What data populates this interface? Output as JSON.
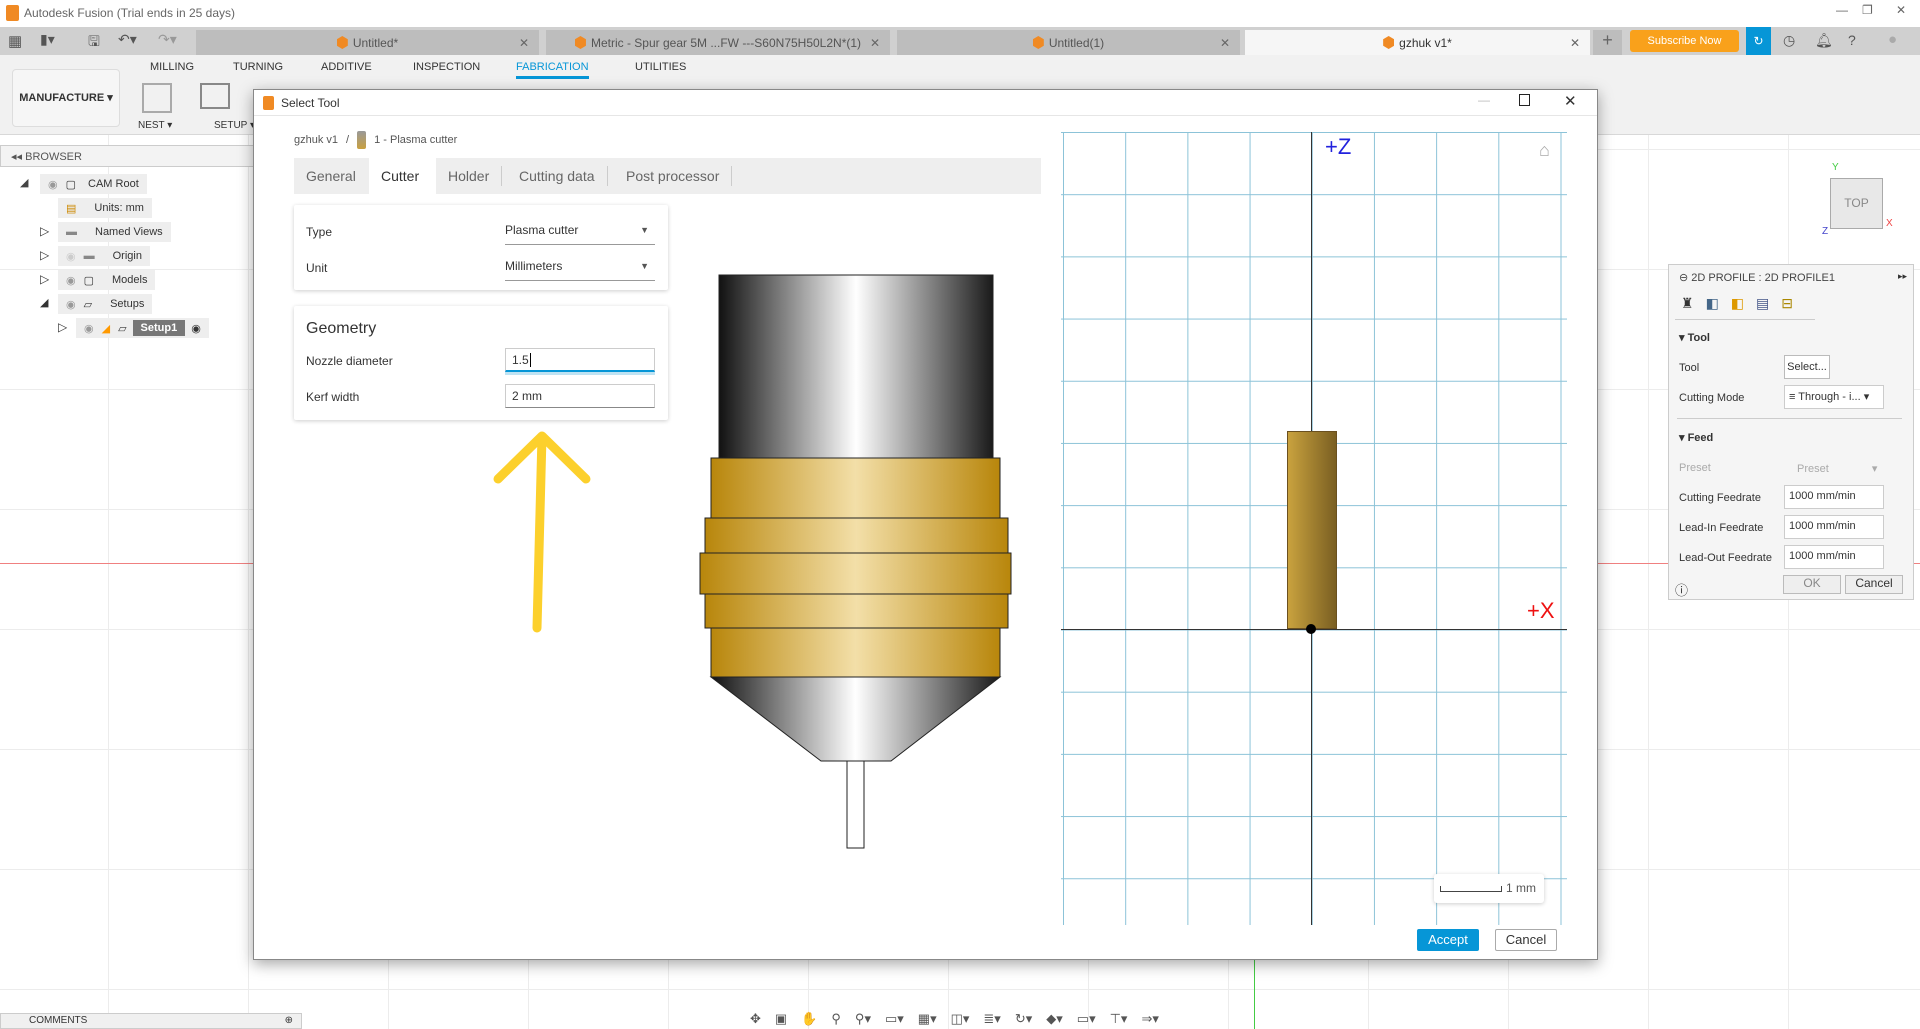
{
  "app": {
    "title": "Autodesk Fusion (Trial ends in 25 days)"
  },
  "doc_tabs": [
    {
      "label": "Untitled*"
    },
    {
      "label": "Metric - Spur gear 5M ...FW ---S60N75H50L2N*(1)"
    },
    {
      "label": "Untitled(1)"
    },
    {
      "label": "gzhuk v1*",
      "active": true
    }
  ],
  "header": {
    "subscribe": "Subscribe Now",
    "accent": "#f9a11b",
    "plus": "+"
  },
  "toolbar": {
    "workspace": "MANUFACTURE",
    "tabs": [
      "MILLING",
      "TURNING",
      "ADDITIVE",
      "INSPECTION",
      "FABRICATION",
      "UTILITIES"
    ],
    "active_tab": "FABRICATION",
    "nest": "NEST ▾",
    "setup": "SETUP ▾"
  },
  "browser": {
    "title": "BROWSER",
    "items": [
      {
        "label": "CAM Root"
      },
      {
        "label": "Units: mm"
      },
      {
        "label": "Named Views"
      },
      {
        "label": "Origin"
      },
      {
        "label": "Models"
      },
      {
        "label": "Setups"
      },
      {
        "label": "Setup1"
      }
    ]
  },
  "dialog": {
    "title": "Select Tool",
    "breadcrumb": {
      "root": "gzhuk v1",
      "sep": "/",
      "tool": "1 - Plasma cutter"
    },
    "tabs": [
      "General",
      "Cutter",
      "Holder",
      "Cutting data",
      "Post processor"
    ],
    "active_tab": "Cutter",
    "type_label": "Type",
    "type_value": "Plasma cutter",
    "unit_label": "Unit",
    "unit_value": "Millimeters",
    "geometry_title": "Geometry",
    "nozzle_label": "Nozzle diameter",
    "nozzle_value": "1.5",
    "kerf_label": "Kerf width",
    "kerf_value": "2 mm",
    "axis_z": "+Z",
    "axis_x": "+X",
    "scale": "1 mm",
    "accept": "Accept",
    "cancel": "Cancel",
    "accent": "#0696d7"
  },
  "panel": {
    "title": "2D PROFILE : 2D PROFILE1",
    "tool_section": "Tool",
    "tool_label": "Tool",
    "tool_button": "Select...",
    "mode_label": "Cutting Mode",
    "mode_value": "Through - i...",
    "feed_section": "Feed",
    "preset_label": "Preset",
    "preset_value": "Preset",
    "cutting_label": "Cutting Feedrate",
    "cutting_value": "1000 mm/min",
    "leadin_label": "Lead-In Feedrate",
    "leadin_value": "1000 mm/min",
    "leadout_label": "Lead-Out Feedrate",
    "leadout_value": "1000 mm/min",
    "ok": "OK",
    "cancel": "Cancel"
  },
  "viewcube": {
    "face": "TOP",
    "x": "X",
    "y": "Y",
    "z": "Z"
  },
  "comments": "COMMENTS"
}
